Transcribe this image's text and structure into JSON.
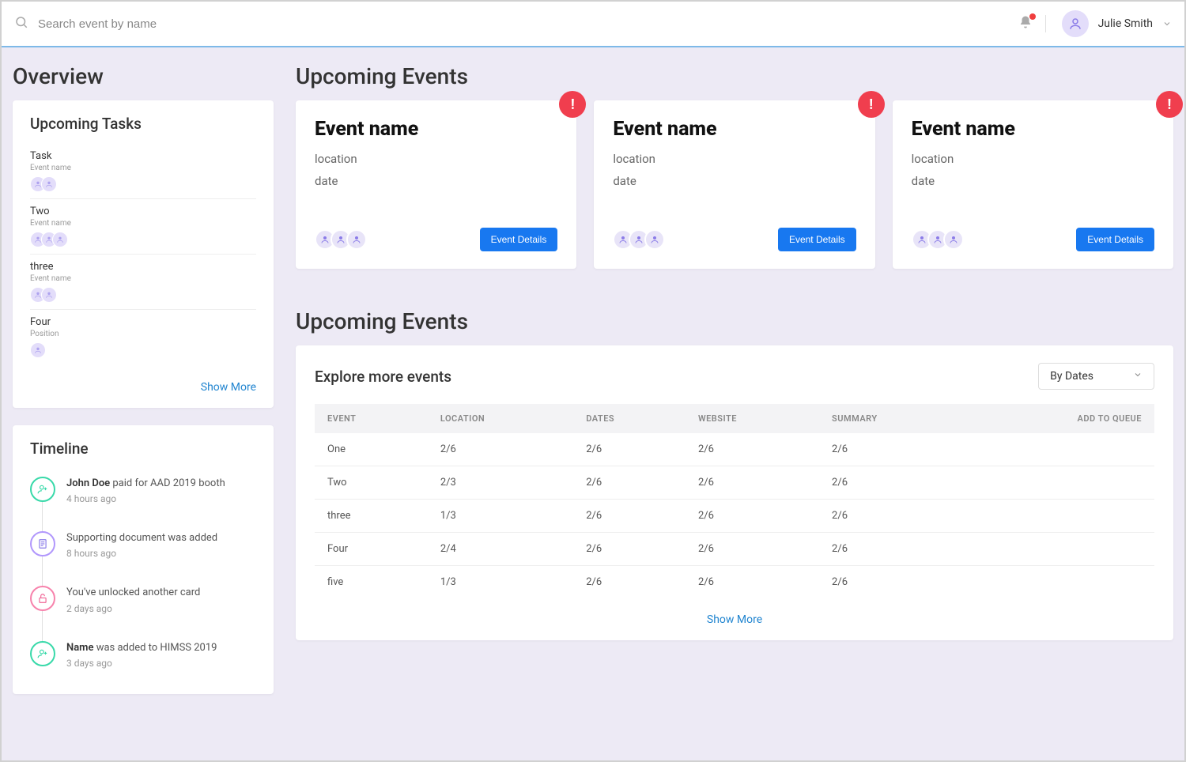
{
  "header": {
    "search_placeholder": "Search event by name",
    "user_name": "Julie Smith"
  },
  "overview": {
    "title": "Overview",
    "tasks_title": "Upcoming Tasks",
    "show_more": "Show More",
    "tasks": [
      {
        "name": "Task",
        "sub": "Event name",
        "avatars": 2
      },
      {
        "name": "Two",
        "sub": "Event name",
        "avatars": 3
      },
      {
        "name": "three",
        "sub": "Event name",
        "avatars": 2
      },
      {
        "name": "Four",
        "sub": "Position",
        "avatars": 1
      }
    ],
    "timeline_title": "Timeline",
    "timeline": [
      {
        "text_html": "<span class='bold'>John Doe</span> paid for AAD 2019 booth",
        "time": "4 hours ago",
        "color": "c-green",
        "icon": "user-plus"
      },
      {
        "text_html": "Supporting document was added",
        "time": "8 hours ago",
        "color": "c-purple",
        "icon": "doc"
      },
      {
        "text_html": "You've unlocked another card",
        "time": "2 days ago",
        "color": "c-pink",
        "icon": "lock"
      },
      {
        "text_html": "<span class='bold'>Name</span> was added to HIMSS 2019",
        "time": "3 days ago",
        "color": "c-green",
        "icon": "user-plus"
      }
    ]
  },
  "events_header": "Upcoming Events",
  "event_cards": [
    {
      "title": "Event name",
      "location": "location",
      "date": "date",
      "button": "Event Details"
    },
    {
      "title": "Event name",
      "location": "location",
      "date": "date",
      "button": "Event Details"
    },
    {
      "title": "Event name",
      "location": "location",
      "date": "date",
      "button": "Event Details"
    }
  ],
  "explore": {
    "heading": "Upcoming Events",
    "title": "Explore more events",
    "sort_label": "By Dates",
    "show_more": "Show More",
    "columns": [
      "Event",
      "Location",
      "Dates",
      "Website",
      "Summary",
      "Add to Queue"
    ],
    "rows": [
      {
        "event": "One",
        "location": "2/6",
        "dates": "2/6",
        "website": "2/6",
        "summary": "2/6"
      },
      {
        "event": "Two",
        "location": "2/3",
        "dates": "2/6",
        "website": "2/6",
        "summary": "2/6"
      },
      {
        "event": "three",
        "location": "1/3",
        "dates": "2/6",
        "website": "2/6",
        "summary": "2/6"
      },
      {
        "event": "Four",
        "location": "2/4",
        "dates": "2/6",
        "website": "2/6",
        "summary": "2/6"
      },
      {
        "event": "five",
        "location": "1/3",
        "dates": "2/6",
        "website": "2/6",
        "summary": "2/6"
      }
    ]
  }
}
